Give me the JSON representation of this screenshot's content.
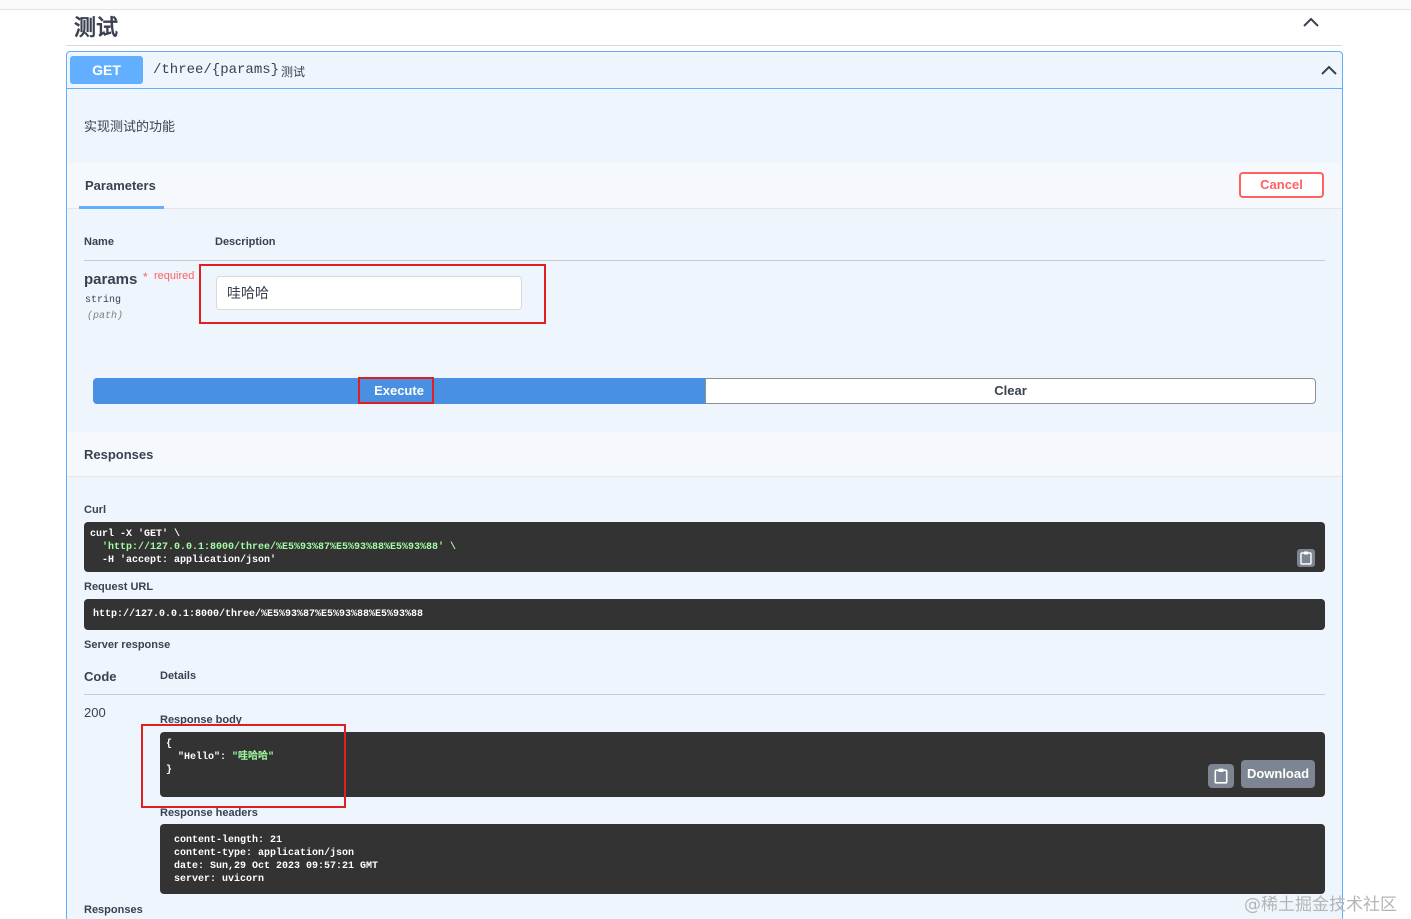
{
  "tag": {
    "title": "测试"
  },
  "operation": {
    "method": "GET",
    "path": "/three/{params}",
    "summary": "测试",
    "description": "实现测试的功能"
  },
  "parameters": {
    "tab_label": "Parameters",
    "cancel_label": "Cancel",
    "col_name": "Name",
    "col_description": "Description",
    "param": {
      "name": "params",
      "required_star": "*",
      "required_label": "required",
      "type": "string",
      "in": "(path)",
      "value": "哇哈哈"
    }
  },
  "actions": {
    "execute_label": "Execute",
    "clear_label": "Clear"
  },
  "responses": {
    "title": "Responses",
    "curl_label": "Curl",
    "curl_lines": [
      "curl -X 'GET' \\",
      "'http://127.0.0.1:8000/three/%E5%93%87%E5%93%88%E5%93%88' \\",
      "-H 'accept: application/json'"
    ],
    "request_url_label": "Request URL",
    "request_url": "http://127.0.0.1:8000/three/%E5%93%87%E5%93%88%E5%93%88",
    "server_response_label": "Server response",
    "code_label": "Code",
    "details_label": "Details",
    "code_value": "200",
    "body_label": "Response body",
    "body_lines": {
      "open": "{",
      "key": "\"Hello\": ",
      "value": "\"哇哈哈\"",
      "close": "}"
    },
    "download_label": "Download",
    "headers_label": "Response headers",
    "headers_lines": [
      "content-length: 21",
      "content-type: application/json",
      "date: Sun,29 Oct 2023 09:57:21 GMT",
      "server: uvicorn"
    ],
    "bottom_label": "Responses"
  },
  "watermark": "@稀土掘金技术社区",
  "colors": {
    "get_blue": "#61affe",
    "execute_blue": "#4990e2",
    "danger": "#ff6060",
    "code_bg": "#333333",
    "string_green": "#a2fca2",
    "annotation_red": "#e02020"
  }
}
